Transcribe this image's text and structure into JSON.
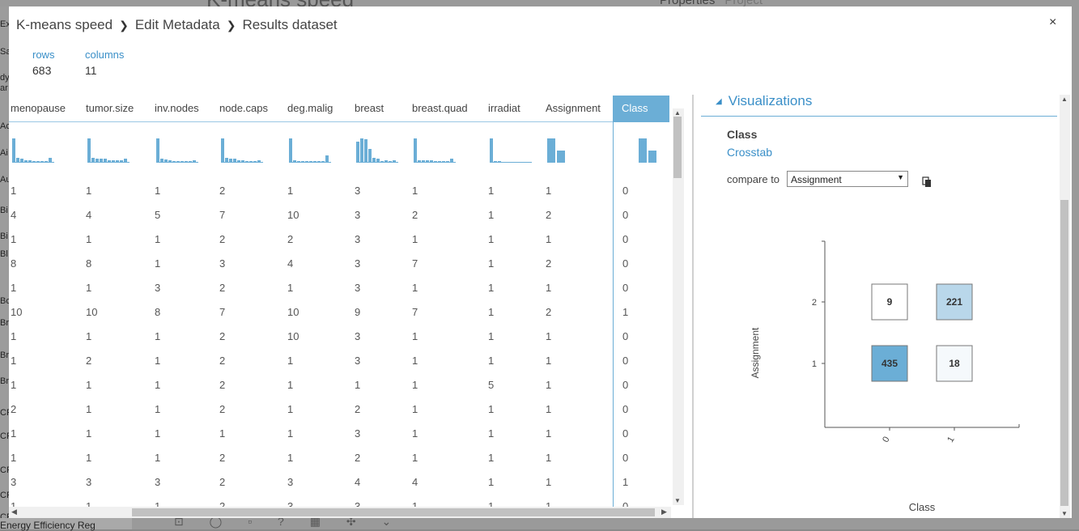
{
  "background": {
    "title": "K-means speed",
    "properties": "Properties",
    "project": "Project",
    "left_items": [
      "Exp",
      "Sa",
      "dy",
      "ar",
      "Ac",
      "Ai",
      "Au",
      "Bi",
      "Bi",
      "Bl",
      "Bo",
      "Br",
      "Br",
      "Br",
      "CF",
      "CF",
      "CF",
      "CF",
      "CF"
    ],
    "bottom_label": "Energy Efficiency Reg"
  },
  "breadcrumb": [
    "K-means speed",
    "Edit Metadata",
    "Results dataset"
  ],
  "close_label": "×",
  "stats": {
    "rows_label": "rows",
    "rows_value": "683",
    "columns_label": "columns",
    "columns_value": "11"
  },
  "table": {
    "columns": [
      "menopause",
      "tumor.size",
      "inv.nodes",
      "node.caps",
      "deg.malig",
      "breast",
      "breast.quad",
      "irradiat",
      "Assignment",
      "Class"
    ],
    "rows": [
      [
        "1",
        "1",
        "1",
        "2",
        "1",
        "3",
        "1",
        "1",
        "1",
        "0"
      ],
      [
        "4",
        "4",
        "5",
        "7",
        "10",
        "3",
        "2",
        "1",
        "2",
        "0"
      ],
      [
        "1",
        "1",
        "1",
        "2",
        "2",
        "3",
        "1",
        "1",
        "1",
        "0"
      ],
      [
        "8",
        "8",
        "1",
        "3",
        "4",
        "3",
        "7",
        "1",
        "2",
        "0"
      ],
      [
        "1",
        "1",
        "3",
        "2",
        "1",
        "3",
        "1",
        "1",
        "1",
        "0"
      ],
      [
        "10",
        "10",
        "8",
        "7",
        "10",
        "9",
        "7",
        "1",
        "2",
        "1"
      ],
      [
        "1",
        "1",
        "1",
        "2",
        "10",
        "3",
        "1",
        "1",
        "1",
        "0"
      ],
      [
        "1",
        "2",
        "1",
        "2",
        "1",
        "3",
        "1",
        "1",
        "1",
        "0"
      ],
      [
        "1",
        "1",
        "1",
        "2",
        "1",
        "1",
        "1",
        "5",
        "1",
        "0"
      ],
      [
        "2",
        "1",
        "1",
        "2",
        "1",
        "2",
        "1",
        "1",
        "1",
        "0"
      ],
      [
        "1",
        "1",
        "1",
        "1",
        "1",
        "3",
        "1",
        "1",
        "1",
        "0"
      ],
      [
        "1",
        "1",
        "1",
        "2",
        "1",
        "2",
        "1",
        "1",
        "1",
        "0"
      ],
      [
        "3",
        "3",
        "3",
        "2",
        "3",
        "4",
        "4",
        "1",
        "1",
        "1"
      ],
      [
        "1",
        "1",
        "1",
        "2",
        "3",
        "3",
        "1",
        "1",
        "1",
        "0"
      ]
    ],
    "histograms": [
      [
        1.0,
        0.2,
        0.15,
        0.1,
        0.1,
        0.05,
        0.05,
        0.05,
        0.05,
        0.2
      ],
      [
        1.0,
        0.2,
        0.15,
        0.15,
        0.15,
        0.1,
        0.1,
        0.1,
        0.1,
        0.15
      ],
      [
        1.0,
        0.15,
        0.12,
        0.1,
        0.08,
        0.06,
        0.05,
        0.05,
        0.05,
        0.1
      ],
      [
        1.0,
        0.2,
        0.15,
        0.15,
        0.1,
        0.1,
        0.08,
        0.08,
        0.05,
        0.1
      ],
      [
        1.0,
        0.1,
        0.05,
        0.05,
        0.05,
        0.05,
        0.05,
        0.05,
        0.05,
        0.3
      ],
      [
        0.85,
        1.0,
        0.95,
        0.55,
        0.2,
        0.15,
        0.05,
        0.1,
        0.05,
        0.1
      ],
      [
        1.0,
        0.1,
        0.1,
        0.1,
        0.1,
        0.05,
        0.05,
        0.05,
        0.05,
        0.15
      ],
      [
        1.0,
        0.05,
        0.05,
        0.03,
        0.03,
        0.02,
        0.02,
        0.02,
        0.02,
        0.03
      ],
      [
        1.0,
        0.5
      ],
      [
        1.0,
        0.5
      ]
    ]
  },
  "visualizations": {
    "header": "Visualizations",
    "column": "Class",
    "type": "Crosstab",
    "compare_label": "compare to",
    "compare_value": "Assignment",
    "crosstab": {
      "x_label": "Class",
      "y_label": "Assignment",
      "x_ticks": [
        "0",
        "1"
      ],
      "y_ticks": [
        "2",
        "1"
      ],
      "cells": [
        {
          "row": "2",
          "col": "0",
          "value": "9",
          "shade": "#ffffff"
        },
        {
          "row": "2",
          "col": "1",
          "value": "221",
          "shade": "#b9d7ea"
        },
        {
          "row": "1",
          "col": "0",
          "value": "435",
          "shade": "#6baed6"
        },
        {
          "row": "1",
          "col": "1",
          "value": "18",
          "shade": "#f5f9fc"
        }
      ]
    }
  },
  "colors": {
    "accent": "#3a8fc8",
    "bar": "#6baed6"
  }
}
